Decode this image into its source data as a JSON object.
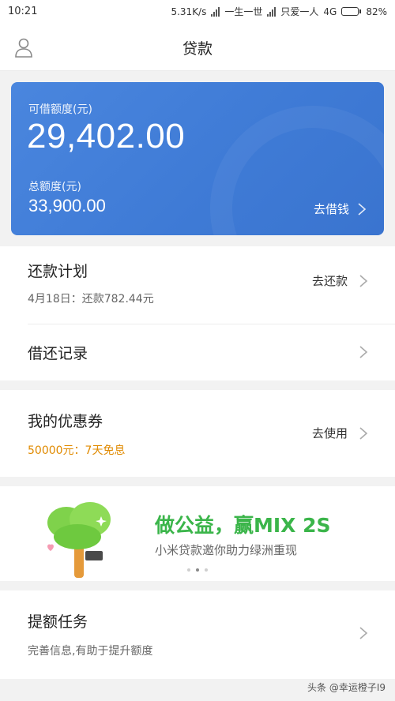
{
  "status_bar": {
    "time": "10:21",
    "speed": "5.31K/s",
    "carrier1": "一生一世",
    "carrier2": "只爱一人",
    "network": "4G",
    "battery": "82%",
    "battery_level": 0.82
  },
  "header": {
    "title": "贷款",
    "user_icon": "user-icon"
  },
  "credit_card": {
    "available_label": "可借额度(元)",
    "available_value": "29,402.00",
    "total_label": "总额度(元)",
    "total_value": "33,900.00",
    "action": "去借钱"
  },
  "repayment": {
    "title": "还款计划",
    "subtitle": "4月18日：还款782.44元",
    "action": "去还款"
  },
  "records": {
    "title": "借还记录"
  },
  "coupons": {
    "title": "我的优惠券",
    "subtitle": "50000元：7天免息",
    "action": "去使用"
  },
  "banner": {
    "title": "做公益，赢MIX 2S",
    "subtitle": "小米贷款邀你助力绿洲重现",
    "active_dot": 2,
    "dot_count": 3
  },
  "limit_task": {
    "title": "提额任务",
    "subtitle": "完善信息,有助于提升额度"
  },
  "watermark": "头条 @幸运橙子I9",
  "colors": {
    "card_blue": "#4a86de",
    "green_accent": "#3bb54a",
    "coupon_orange": "#e08a00"
  }
}
